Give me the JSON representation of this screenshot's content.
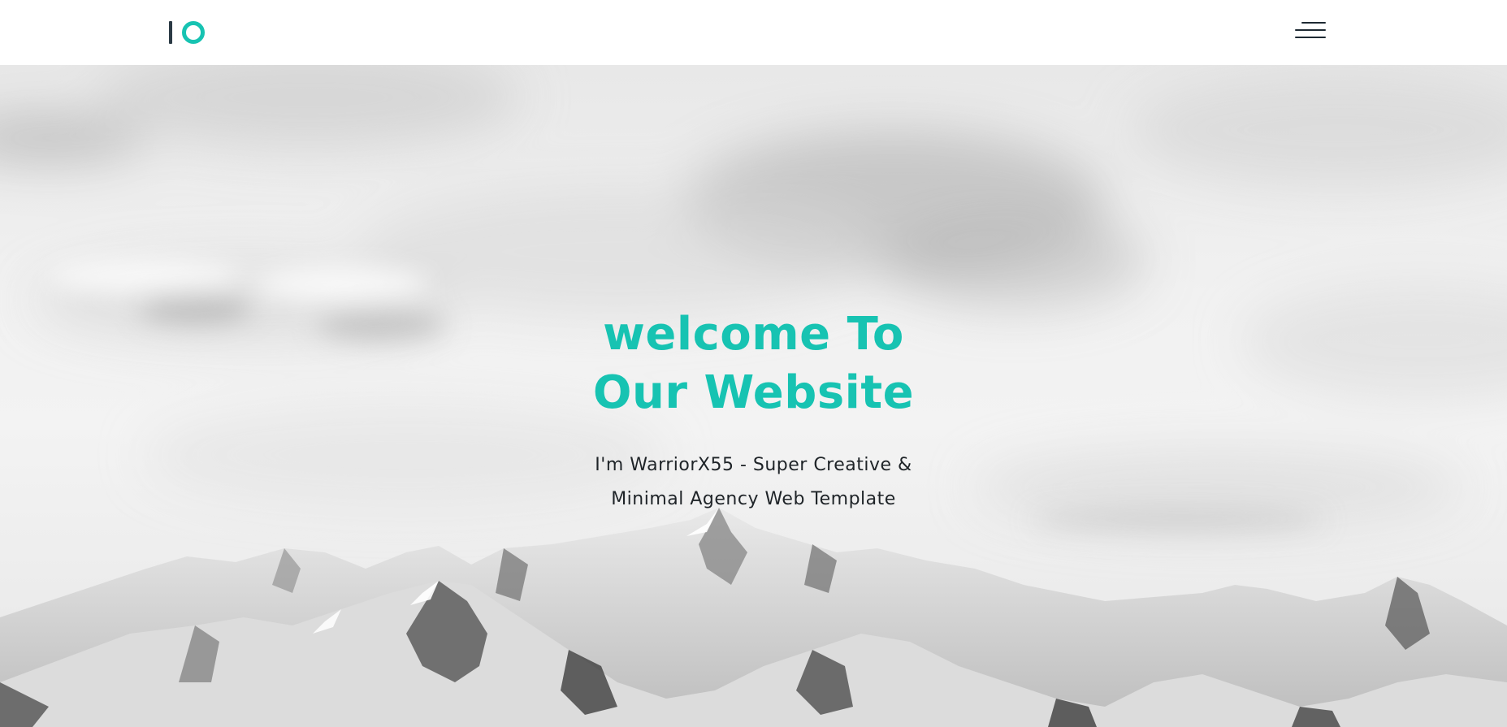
{
  "header": {
    "logo_text": "IO",
    "menu_icon": "hamburger-menu-icon"
  },
  "hero": {
    "title": "welcome To\nOur Website",
    "subtitle": "I'm WarriorX55 - Super Creative &\nMinimal Agency Web Template",
    "background": "grayscale-cloudy-sky-with-snowy-mountains"
  },
  "colors": {
    "accent": "#17c3b2",
    "logo_dark": "#2b3a45",
    "text_dark": "#1f2428"
  }
}
